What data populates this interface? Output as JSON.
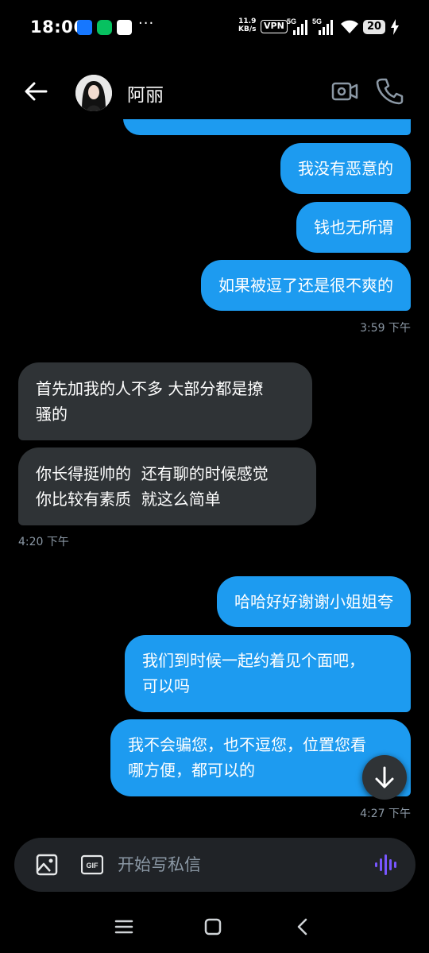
{
  "status_bar": {
    "time": "18:06",
    "more": "···",
    "speed_value": "11.9",
    "speed_unit": "KB/s",
    "vpn": "VPN",
    "sim1": "5G",
    "sim2": "5G",
    "battery": "20",
    "app_icon_colors": [
      "#1677ff",
      "#07c160",
      "#ffffff"
    ]
  },
  "header": {
    "contact_name": "阿丽",
    "icons": [
      "back-arrow-icon",
      "video-camera-icon",
      "phone-icon"
    ]
  },
  "messages": [
    {
      "dir": "out",
      "text": "我没有恶意的"
    },
    {
      "dir": "out",
      "text": "钱也无所谓"
    },
    {
      "dir": "out",
      "text": "如果被逗了还是很不爽的"
    },
    {
      "dir": "time",
      "text": "3:59 下午"
    },
    {
      "dir": "in",
      "lines": [
        "首先加我的人不多 大部分都是撩",
        "骚的"
      ]
    },
    {
      "dir": "in",
      "lines": [
        "你长得挺帅的  还有聊的时候感觉",
        "你比较有素质  就这么简单"
      ]
    },
    {
      "dir": "time",
      "text": "4:20 下午"
    },
    {
      "dir": "out",
      "text": "哈哈好好谢谢小姐姐夸"
    },
    {
      "dir": "out",
      "lines": [
        "我们到时候一起约着见个面吧，",
        "可以吗"
      ]
    },
    {
      "dir": "out",
      "lines": [
        "我不会骗您，也不逗您，位置您看",
        "哪方便，都可以的"
      ]
    },
    {
      "dir": "time",
      "text": "4:27 下午"
    }
  ],
  "composer": {
    "placeholder": "开始写私信",
    "gif_label": "GIF"
  },
  "colors": {
    "outgoing_bubble": "#1d9bf0",
    "incoming_bubble": "#2f3336",
    "timestamp": "#8b98a5",
    "voice_accent": "#7856ff",
    "background": "#000000"
  }
}
